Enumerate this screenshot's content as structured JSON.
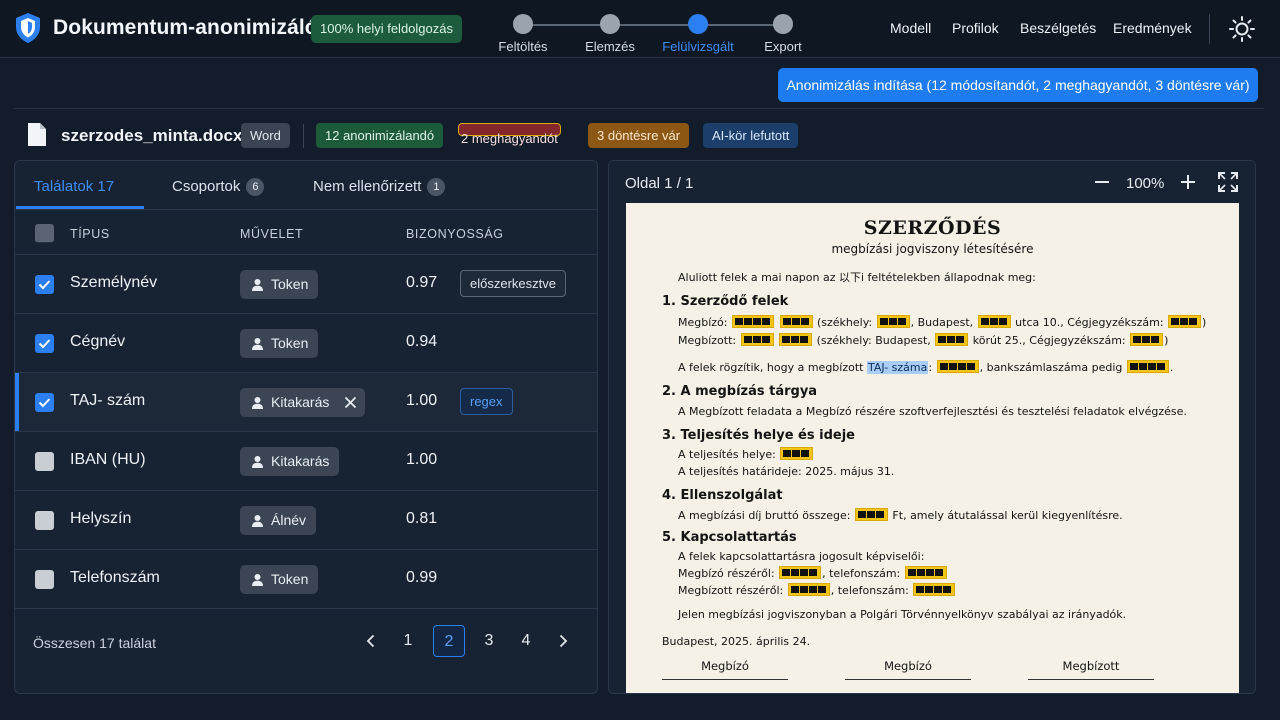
{
  "header": {
    "title": "Dokumentum-anonimizáló",
    "local_badge": "100% helyi feldolgozás",
    "steps": [
      {
        "label": "Feltöltés",
        "active": false
      },
      {
        "label": "Elemzés",
        "active": false
      },
      {
        "label": "Felülvizsgált",
        "active": true
      },
      {
        "label": "Export",
        "active": false
      }
    ],
    "nav": [
      "Modell",
      "Profilok",
      "Beszélgetés",
      "Eredmények"
    ]
  },
  "actions": {
    "start_label": "Anonimizálás indítása (12 módosítandót, 2 meghagyandót, 3 döntésre vár)"
  },
  "file": {
    "name": "szerzodes_minta.docx",
    "type": "Word",
    "chips": [
      "12 anonimizálandó",
      "2 meghagyandót",
      "3 döntésre vár",
      "AI-kör lefutott"
    ]
  },
  "colors": {
    "accent": "#2b7ff0",
    "redaction": "#f2c414"
  },
  "left": {
    "tabs": [
      {
        "label": "Találatok 17"
      },
      {
        "label": "Csoportok",
        "count": "6"
      },
      {
        "label": "Nem ellenőrizett",
        "count": "1"
      }
    ],
    "columns": [
      "TÍPUS",
      "MŰVELET",
      "BIZONYOSSÁG"
    ],
    "rows": [
      {
        "type": "Személynév",
        "action": "Token",
        "confidence": "0.97",
        "tag": "előszerkesztve",
        "checked": true
      },
      {
        "type": "Cégnév",
        "action": "Token",
        "confidence": "0.94",
        "tag": "",
        "checked": true
      },
      {
        "type": "TAJ- szám",
        "action": "Kitakarás",
        "confidence": "1.00",
        "tag": "regex",
        "checked": true
      },
      {
        "type": "IBAN (HU)",
        "action": "Kitakarás",
        "confidence": "1.00",
        "tag": "",
        "checked": false
      },
      {
        "type": "Helyszín",
        "action": "Álnév",
        "confidence": "0.81",
        "tag": "",
        "checked": false
      },
      {
        "type": "Telefonszám",
        "action": "Token",
        "confidence": "0.99",
        "tag": "",
        "checked": false
      }
    ],
    "total": "Összesen 17 találat",
    "pages": [
      "1",
      "2",
      "3",
      "4"
    ]
  },
  "preview": {
    "page_indicator": "Oldal 1 / 1",
    "zoom": "100%",
    "doc": {
      "title": "SZERZŐDÉS",
      "subtitle": "megbízási jogviszony létesítésére",
      "intro": "Aluliott felek a mai napon az 以下i feltételekben állapodnak meg:",
      "s1": "1. Szerződő felek",
      "s1_a1": "Megbízó: ",
      "s1_a2": " (székhely: ",
      "s1_a3": ", Budapest, ",
      "s1_a4": " utca 10., Cégjegyzékszám: ",
      "s1_a5": ")",
      "s1_b1": "Megbízott: ",
      "s1_b2": " (székhely: Budapest, ",
      "s1_b3": " körút 25., Cégjegyzékszám: ",
      "s1_b4": ")",
      "s1_c1": "A felek rögzítik, hogy a megbízott ",
      "s1_c_hl": "TAJ- száma",
      "s1_c2": ": ",
      "s1_c3": ", bankszámlaszáma pedig ",
      "s1_c4": ".",
      "s2": "2. A megbízás tárgya",
      "s2_a": "A Megbízott feladata a Megbízó részére szoftverfejlesztési és tesztelési feladatok elvégzése.",
      "s3": "3. Teljesítés helye és ideje",
      "s3_a": "A teljesítés helye: ",
      "s3_b": "A teljesítés határideje: 2025. május 31.",
      "s4": "4. Ellenszolgálat",
      "s4_a1": "A megbízási díj bruttó összege: ",
      "s4_a2": " Ft, amely átutalással kerül kiegyenlítésre.",
      "s5": "5. Kapcsolattartás",
      "s5_a": "A felek kapcsolattartásra jogosult képviselői:",
      "s5_b1": "Megbízó részéről: ",
      "s5_b2": ", telefonszám: ",
      "s5_c1": "Megbízott részéről: ",
      "s5_c2": ", telefonszám: ",
      "closing": "Jelen megbízási jogviszonyban a Polgári Törvénnyelkönyv szabályai az irányadók.",
      "place_date": "Budapest, 2025. április 24.",
      "sig": [
        "Megbízó",
        "Megbízó",
        "Megbízott"
      ]
    }
  }
}
